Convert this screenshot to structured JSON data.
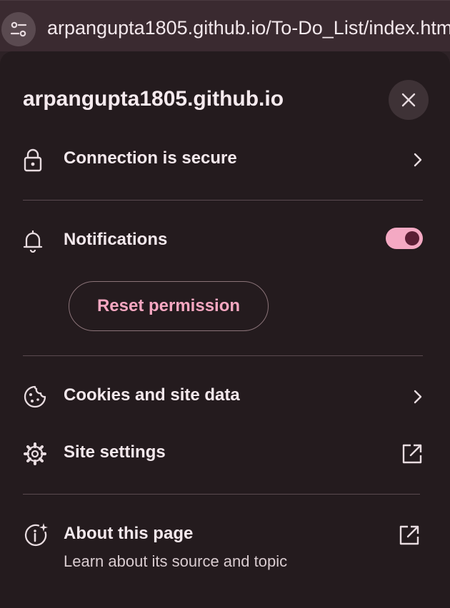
{
  "url_bar": {
    "url": "arpangupta1805.github.io/To-Do_List/index.html",
    "icon": "tune-icon"
  },
  "popup": {
    "site_title": "arpangupta1805.github.io",
    "close_icon": "close-icon",
    "connection": {
      "label": "Connection is secure",
      "icon": "lock-icon",
      "trail_icon": "chevron-right-icon"
    },
    "notifications": {
      "label": "Notifications",
      "icon": "bell-icon",
      "toggle_on": true,
      "toggle_color": "#f4a9c3"
    },
    "reset_permission": {
      "label": "Reset permission",
      "color": "#f6a7c1"
    },
    "cookies": {
      "label": "Cookies and site data",
      "icon": "cookie-icon",
      "trail_icon": "chevron-right-icon"
    },
    "site_settings": {
      "label": "Site settings",
      "icon": "gear-icon",
      "trail_icon": "open-external-icon"
    },
    "about": {
      "label": "About this page",
      "sublabel": "Learn about its source and topic",
      "icon": "info-sparkle-icon",
      "trail_icon": "open-external-icon"
    }
  }
}
